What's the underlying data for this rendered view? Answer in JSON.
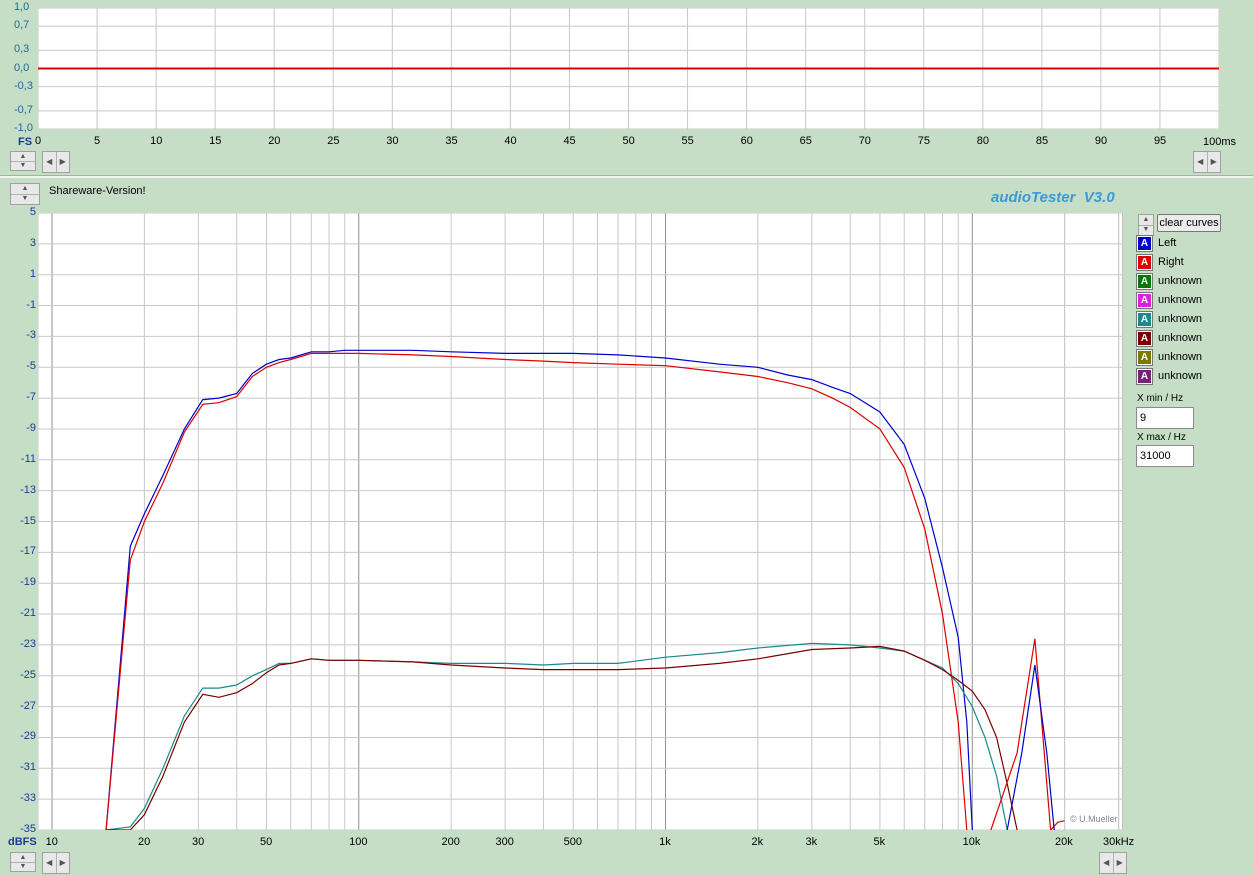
{
  "top_panel": {
    "unit_label": "FS",
    "x_unit_label": "100ms",
    "y_ticks": [
      "1,0",
      "0,7",
      "0,3",
      "0,0",
      "-0,3",
      "-0,7",
      "-1,0"
    ],
    "x_ticks": [
      "0",
      "5",
      "10",
      "15",
      "20",
      "25",
      "30",
      "35",
      "40",
      "45",
      "50",
      "55",
      "60",
      "65",
      "70",
      "75",
      "80",
      "85",
      "90",
      "95"
    ]
  },
  "shareware_label": "Shareware-Version!",
  "brand": "audioTester  V3.0",
  "watermark": "© U.Mueller",
  "bottom_panel": {
    "unit_label": "dBFS",
    "x_unit_label": "30kHz",
    "y_ticks": [
      "5",
      "3",
      "1",
      "-1",
      "-3",
      "-5",
      "-7",
      "-9",
      "-11",
      "-13",
      "-15",
      "-17",
      "-19",
      "-21",
      "-23",
      "-25",
      "-27",
      "-29",
      "-31",
      "-33",
      "-35"
    ],
    "x_ticks": [
      "10",
      "20",
      "30",
      "50",
      "100",
      "200",
      "300",
      "500",
      "1k",
      "2k",
      "3k",
      "5k",
      "10k",
      "20k"
    ]
  },
  "controls": {
    "clear_curves": "clear curves",
    "xmin_label": "X min / Hz",
    "xmin_value": "9",
    "xmax_label": "X max / Hz",
    "xmax_value": "31000"
  },
  "legend": [
    {
      "label": "Left",
      "color": "#0000cc",
      "icon": "A"
    },
    {
      "label": "Right",
      "color": "#dd0000",
      "icon": "A"
    },
    {
      "label": "unknown",
      "color": "#007a00",
      "icon": "A"
    },
    {
      "label": "unknown",
      "color": "#e020e0",
      "icon": "A"
    },
    {
      "label": "unknown",
      "color": "#1a8a8a",
      "icon": "A"
    },
    {
      "label": "unknown",
      "color": "#7a0000",
      "icon": "A"
    },
    {
      "label": "unknown",
      "color": "#7a7a00",
      "icon": "A"
    },
    {
      "label": "unknown",
      "color": "#7a207a",
      "icon": "A"
    }
  ],
  "chart_data": [
    {
      "type": "line",
      "xlabel": "100ms",
      "ylabel": "FS",
      "xlim": [
        0,
        100
      ],
      "ylim": [
        -1.0,
        1.0
      ],
      "grid": true,
      "series": [
        {
          "name": "Left",
          "color": "#0000cc",
          "x": [
            0,
            100
          ],
          "y": [
            0.0,
            0.0
          ]
        },
        {
          "name": "Right",
          "color": "#dd0000",
          "x": [
            0,
            100
          ],
          "y": [
            0.0,
            0.0
          ]
        }
      ]
    },
    {
      "type": "line",
      "xscale": "log",
      "xlabel": "30kHz",
      "ylabel": "dBFS",
      "xlim": [
        9,
        31000
      ],
      "ylim": [
        -35,
        5
      ],
      "grid": true,
      "series": [
        {
          "name": "Left",
          "color": "#0000cc",
          "x": [
            15,
            18,
            20,
            23,
            27,
            31,
            35,
            40,
            45,
            50,
            55,
            60,
            70,
            80,
            90,
            100,
            150,
            200,
            300,
            400,
            500,
            700,
            1000,
            1500,
            2000,
            2500,
            3000,
            3500,
            4000,
            5000,
            6000,
            7000,
            8000,
            9000,
            9600,
            10000
          ],
          "y": [
            -35,
            -16.6,
            -14.5,
            -12,
            -9,
            -7.1,
            -7.0,
            -6.7,
            -5.4,
            -4.8,
            -4.5,
            -4.4,
            -4.0,
            -4.0,
            -3.9,
            -3.9,
            -3.9,
            -4.0,
            -4.1,
            -4.1,
            -4.1,
            -4.2,
            -4.4,
            -4.8,
            -5.0,
            -5.5,
            -5.8,
            -6.3,
            -6.7,
            -7.9,
            -10.0,
            -13.5,
            -18.0,
            -22.5,
            -28,
            -35
          ]
        },
        {
          "name": "Right",
          "color": "#dd0000",
          "x": [
            15,
            18,
            20,
            23,
            27,
            31,
            35,
            40,
            45,
            50,
            55,
            60,
            70,
            80,
            90,
            100,
            150,
            200,
            300,
            400,
            500,
            700,
            1000,
            1500,
            2000,
            2500,
            3000,
            3500,
            4000,
            5000,
            6000,
            7000,
            8000,
            9000,
            9600
          ],
          "y": [
            -35,
            -17.5,
            -15,
            -12.5,
            -9.2,
            -7.4,
            -7.3,
            -6.9,
            -5.6,
            -5.0,
            -4.7,
            -4.5,
            -4.1,
            -4.1,
            -4.1,
            -4.1,
            -4.2,
            -4.3,
            -4.5,
            -4.6,
            -4.7,
            -4.8,
            -4.9,
            -5.3,
            -5.6,
            -6.0,
            -6.4,
            -7.0,
            -7.6,
            -9.0,
            -11.5,
            -15.5,
            -21,
            -28,
            -35
          ]
        },
        {
          "name": "unknown",
          "color": "#1a8a8a",
          "x": [
            15,
            18,
            20,
            23,
            27,
            31,
            35,
            40,
            45,
            50,
            55,
            60,
            70,
            80,
            100,
            150,
            200,
            300,
            400,
            500,
            700,
            1000,
            1500,
            2000,
            3000,
            4000,
            5000,
            6000,
            7000,
            8000,
            9000,
            10000,
            11000,
            12000,
            13000
          ],
          "y": [
            -35,
            -34.8,
            -33.6,
            -31,
            -27.6,
            -25.8,
            -25.8,
            -25.6,
            -25.0,
            -24.6,
            -24.2,
            -24.2,
            -23.9,
            -24.0,
            -24.0,
            -24.1,
            -24.2,
            -24.2,
            -24.3,
            -24.2,
            -24.2,
            -23.8,
            -23.5,
            -23.2,
            -22.9,
            -23.0,
            -23.2,
            -23.4,
            -24.0,
            -24.5,
            -25.5,
            -27.0,
            -29.0,
            -31.5,
            -35
          ]
        },
        {
          "name": "unknown",
          "color": "#7a0000",
          "x": [
            15,
            18,
            20,
            23,
            27,
            31,
            35,
            40,
            45,
            50,
            55,
            60,
            70,
            80,
            100,
            150,
            200,
            300,
            400,
            500,
            700,
            1000,
            1500,
            2000,
            3000,
            4000,
            5000,
            6000,
            7000,
            8000,
            9000,
            10000,
            11000,
            12000,
            13000,
            14000
          ],
          "y": [
            -35,
            -35,
            -34,
            -31.5,
            -28,
            -26.2,
            -26.4,
            -26.1,
            -25.5,
            -24.8,
            -24.3,
            -24.2,
            -23.9,
            -24.0,
            -24.0,
            -24.1,
            -24.3,
            -24.5,
            -24.6,
            -24.6,
            -24.6,
            -24.5,
            -24.2,
            -23.9,
            -23.3,
            -23.2,
            -23.1,
            -23.4,
            -24.0,
            -24.6,
            -25.3,
            -26.0,
            -27.2,
            -29.0,
            -32.0,
            -35
          ]
        },
        {
          "name": "Right",
          "color": "#dd0000",
          "x": [
            11500,
            14000,
            16000,
            18000,
            19000,
            20000
          ],
          "y": [
            -35,
            -30,
            -22.6,
            -35,
            -34.5,
            -34.4
          ]
        },
        {
          "name": "Left",
          "color": "#0000cc",
          "x": [
            13000,
            14500,
            16000,
            17500,
            18500
          ],
          "y": [
            -35,
            -30,
            -24.3,
            -30,
            -35
          ]
        }
      ]
    }
  ]
}
